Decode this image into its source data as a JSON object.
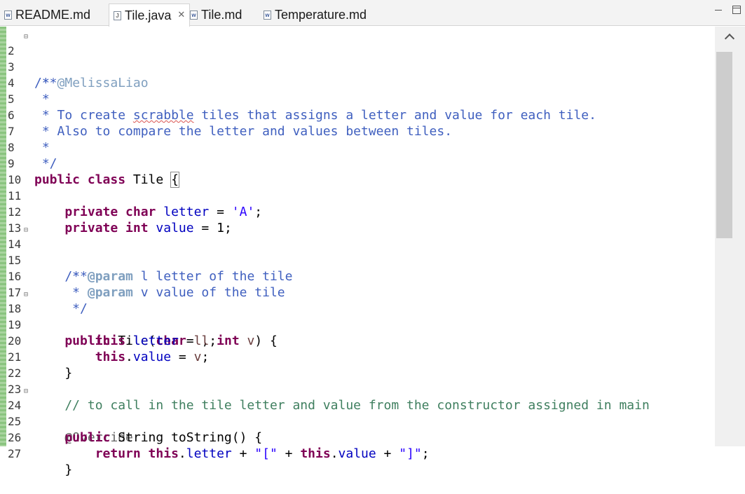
{
  "tabs": [
    {
      "label": "README.md",
      "icon": "markdown-file-icon"
    },
    {
      "label": "Tile.java",
      "icon": "java-file-icon",
      "active": true
    },
    {
      "label": "Tile.md",
      "icon": "markdown-file-icon"
    },
    {
      "label": "Temperature.md",
      "icon": "markdown-file-icon"
    }
  ],
  "close_glyph": "✕",
  "editor": {
    "lines": [
      {
        "n": "2",
        "fold": "⊟"
      },
      {
        "n": "3"
      },
      {
        "n": "4"
      },
      {
        "n": "5"
      },
      {
        "n": "6"
      },
      {
        "n": "7"
      },
      {
        "n": "8"
      },
      {
        "n": "9"
      },
      {
        "n": "10"
      },
      {
        "n": "11"
      },
      {
        "n": "12"
      },
      {
        "n": "13"
      },
      {
        "n": "14",
        "fold": "⊟"
      },
      {
        "n": "15"
      },
      {
        "n": "16"
      },
      {
        "n": "17"
      },
      {
        "n": "18",
        "fold": "⊟"
      },
      {
        "n": "19"
      },
      {
        "n": "20"
      },
      {
        "n": "21"
      },
      {
        "n": "22"
      },
      {
        "n": "23"
      },
      {
        "n": "24",
        "fold": "⊟"
      },
      {
        "n": "25"
      },
      {
        "n": "26"
      },
      {
        "n": "27"
      }
    ],
    "code": {
      "l2": "/**",
      "l3a": " * ",
      "l3b": "@MelissaLiao",
      "l4": " *",
      "l5a": " * To create ",
      "l5b": "scrabble",
      "l5c": " tiles that assigns a letter and value for each tile.",
      "l6": " * Also to compare the letter and values between tiles.",
      "l7": " *",
      "l8": " */",
      "l9a": "public class",
      "l9b": " Tile ",
      "l9c": "{",
      "l11a": "    private char",
      "l11b": " ",
      "l11c": "letter",
      "l11d": " = ",
      "l11e": "'A'",
      "l11f": ";",
      "l12a": "    private int",
      "l12b": " ",
      "l12c": "value",
      "l12d": " = 1;",
      "l14": "    /**",
      "l15a": "     * ",
      "l15b": "@param",
      "l15c": " l letter of the tile",
      "l16a": "     * ",
      "l16b": "@param",
      "l16c": " v value of the tile",
      "l17": "     */",
      "l18a": "    public",
      "l18b": " Tile(",
      "l18c": "char",
      "l18d": " ",
      "l18e": "l",
      "l18f": ", ",
      "l18g": "int",
      "l18h": " ",
      "l18i": "v",
      "l18j": ") {",
      "l19a": "        this",
      "l19b": ".",
      "l19c": "letter",
      "l19d": " = ",
      "l19e": "l",
      "l19f": ";",
      "l20a": "        this",
      "l20b": ".",
      "l20c": "value",
      "l20d": " = ",
      "l20e": "v",
      "l20f": ";",
      "l21": "    }",
      "l23": "    // to call in the tile letter and value from the constructor assigned in main",
      "l24": "    @Override",
      "l25a": "    public",
      "l25b": " String toString() {",
      "l26a": "        return this",
      "l26b": ".",
      "l26c": "letter",
      "l26d": " + ",
      "l26e": "\"[\"",
      "l26f": " + ",
      "l26g": "this",
      "l26h": ".",
      "l26i": "value",
      "l26j": " + ",
      "l26k": "\"]\"",
      "l26l": ";",
      "l27": "    }"
    }
  }
}
